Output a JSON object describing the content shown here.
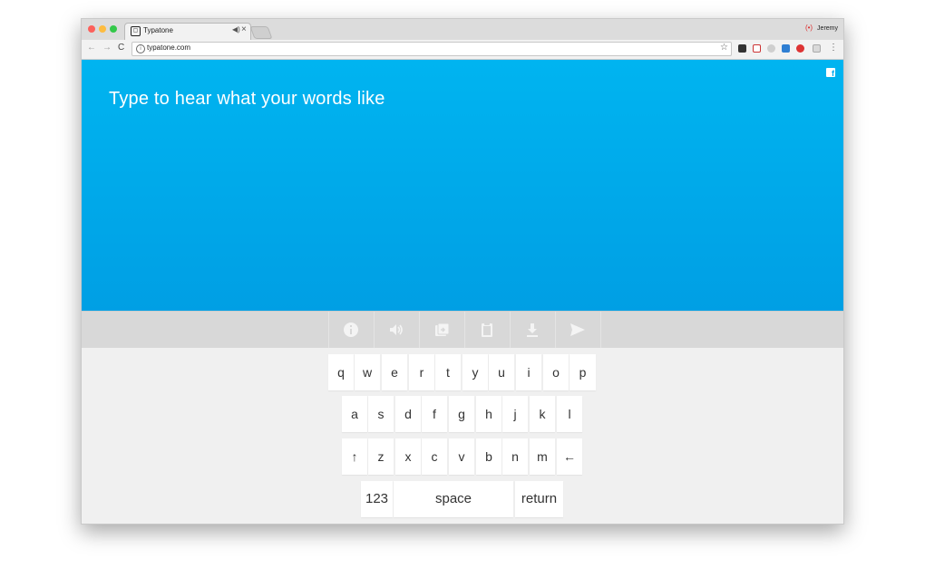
{
  "browser": {
    "tab_title": "Typatone",
    "tab_audio_icon": "speaker-icon",
    "tab_close": "×",
    "profile_name": "Jeremy",
    "url": "typatone.com",
    "nav_back": "←",
    "nav_forward": "→",
    "nav_reload": "C",
    "star": "☆",
    "menu": "⋮"
  },
  "hero": {
    "title": "Type to hear what your words like",
    "background_color": "#00aeef",
    "social_icon": "facebook-icon"
  },
  "action_bar": {
    "icons": [
      "info-icon",
      "sound-icon",
      "shuffle-icon",
      "clipboard-icon",
      "download-icon",
      "send-icon"
    ]
  },
  "keyboard": {
    "row1": [
      "q",
      "w",
      "e",
      "r",
      "t",
      "y",
      "u",
      "i",
      "o",
      "p"
    ],
    "row2": [
      "a",
      "s",
      "d",
      "f",
      "g",
      "h",
      "j",
      "k",
      "l"
    ],
    "row3": [
      "↑",
      "z",
      "x",
      "c",
      "v",
      "b",
      "n",
      "m",
      "←"
    ],
    "row4": [
      "123",
      "space",
      "return"
    ]
  },
  "colors": {
    "accent": "#00aeef",
    "keyboard_bg": "#f0f0f0",
    "action_bar_bg": "#d8d8d8"
  }
}
